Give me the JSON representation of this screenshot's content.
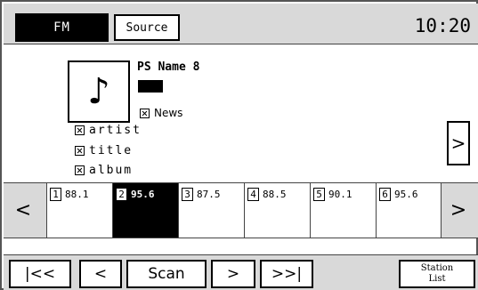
{
  "header": {
    "source_mode": "FM",
    "source_button": "Source",
    "clock": "10:20"
  },
  "info": {
    "ps_name": "PS Name 8",
    "pty": "News",
    "artist": "artist",
    "title": "title",
    "album": "album",
    "next_label": ">",
    "art_icon": "music-note-icon"
  },
  "presets": {
    "prev_label": "<",
    "next_label": ">",
    "items": [
      {
        "num": "1",
        "freq": "88.1",
        "active": false
      },
      {
        "num": "2",
        "freq": "95.6",
        "active": true
      },
      {
        "num": "3",
        "freq": "87.5",
        "active": false
      },
      {
        "num": "4",
        "freq": "88.5",
        "active": false
      },
      {
        "num": "5",
        "freq": "90.1",
        "active": false
      },
      {
        "num": "6",
        "freq": "95.6",
        "active": false
      }
    ]
  },
  "controls": {
    "seek_back": "|<<",
    "tune_back": "<",
    "scan": "Scan",
    "tune_fwd": ">",
    "seek_fwd": ">>|",
    "station_list_line1": "Station",
    "station_list_line2": "List"
  }
}
